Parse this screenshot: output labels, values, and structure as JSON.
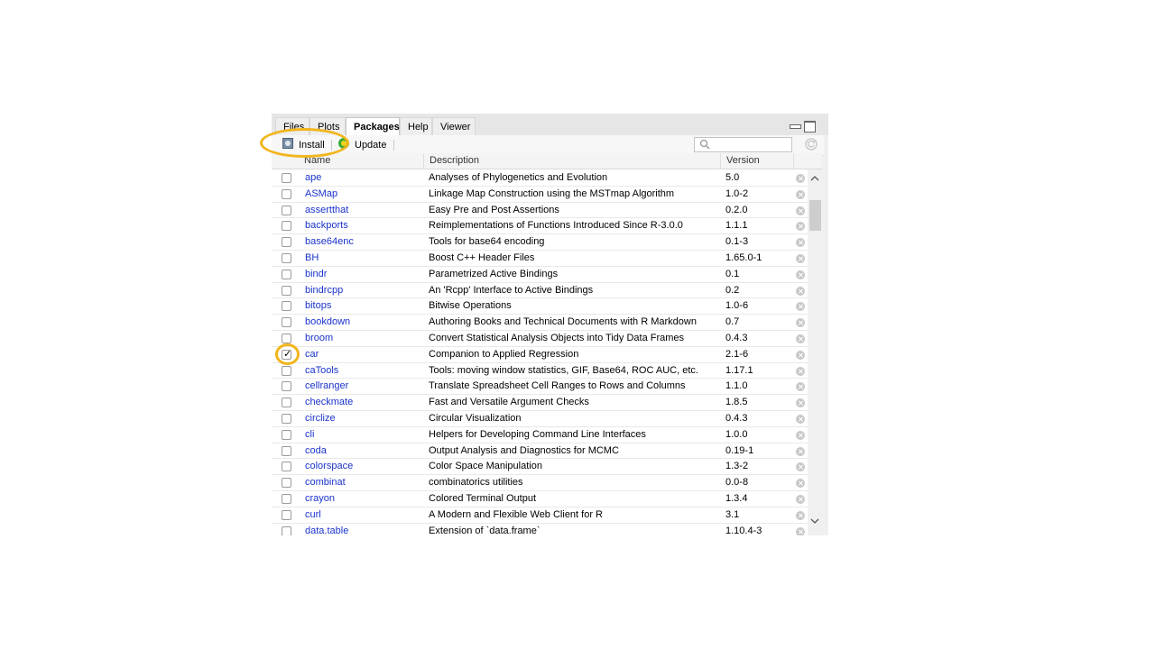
{
  "tabs": [
    {
      "label": "Files",
      "active": false
    },
    {
      "label": "Plots",
      "active": false
    },
    {
      "label": "Packages",
      "active": true
    },
    {
      "label": "Help",
      "active": false
    },
    {
      "label": "Viewer",
      "active": false
    }
  ],
  "toolbar": {
    "install_label": "Install",
    "update_label": "Update",
    "search_value": ""
  },
  "columns": {
    "name": "Name",
    "description": "Description",
    "version": "Version"
  },
  "packages": [
    {
      "name": "ape",
      "description": "Analyses of Phylogenetics and Evolution",
      "version": "5.0",
      "checked": false
    },
    {
      "name": "ASMap",
      "description": "Linkage Map Construction using the MSTmap Algorithm",
      "version": "1.0-2",
      "checked": false
    },
    {
      "name": "assertthat",
      "description": "Easy Pre and Post Assertions",
      "version": "0.2.0",
      "checked": false
    },
    {
      "name": "backports",
      "description": "Reimplementations of Functions Introduced Since R-3.0.0",
      "version": "1.1.1",
      "checked": false
    },
    {
      "name": "base64enc",
      "description": "Tools for base64 encoding",
      "version": "0.1-3",
      "checked": false
    },
    {
      "name": "BH",
      "description": "Boost C++ Header Files",
      "version": "1.65.0-1",
      "checked": false
    },
    {
      "name": "bindr",
      "description": "Parametrized Active Bindings",
      "version": "0.1",
      "checked": false
    },
    {
      "name": "bindrcpp",
      "description": "An 'Rcpp' Interface to Active Bindings",
      "version": "0.2",
      "checked": false
    },
    {
      "name": "bitops",
      "description": "Bitwise Operations",
      "version": "1.0-6",
      "checked": false
    },
    {
      "name": "bookdown",
      "description": "Authoring Books and Technical Documents with R Markdown",
      "version": "0.7",
      "checked": false
    },
    {
      "name": "broom",
      "description": "Convert Statistical Analysis Objects into Tidy Data Frames",
      "version": "0.4.3",
      "checked": false
    },
    {
      "name": "car",
      "description": "Companion to Applied Regression",
      "version": "2.1-6",
      "checked": true
    },
    {
      "name": "caTools",
      "description": "Tools: moving window statistics, GIF, Base64, ROC AUC, etc.",
      "version": "1.17.1",
      "checked": false
    },
    {
      "name": "cellranger",
      "description": "Translate Spreadsheet Cell Ranges to Rows and Columns",
      "version": "1.1.0",
      "checked": false
    },
    {
      "name": "checkmate",
      "description": "Fast and Versatile Argument Checks",
      "version": "1.8.5",
      "checked": false
    },
    {
      "name": "circlize",
      "description": "Circular Visualization",
      "version": "0.4.3",
      "checked": false
    },
    {
      "name": "cli",
      "description": "Helpers for Developing Command Line Interfaces",
      "version": "1.0.0",
      "checked": false
    },
    {
      "name": "coda",
      "description": "Output Analysis and Diagnostics for MCMC",
      "version": "0.19-1",
      "checked": false
    },
    {
      "name": "colorspace",
      "description": "Color Space Manipulation",
      "version": "1.3-2",
      "checked": false
    },
    {
      "name": "combinat",
      "description": "combinatorics utilities",
      "version": "0.0-8",
      "checked": false
    },
    {
      "name": "crayon",
      "description": "Colored Terminal Output",
      "version": "1.3.4",
      "checked": false
    },
    {
      "name": "curl",
      "description": "A Modern and Flexible Web Client for R",
      "version": "3.1",
      "checked": false
    },
    {
      "name": "data.table",
      "description": "Extension of `data.frame`",
      "version": "1.10.4-3",
      "checked": false
    }
  ],
  "colors": {
    "accent_ring": "#f2b51c",
    "package_link": "#1a33cc"
  }
}
